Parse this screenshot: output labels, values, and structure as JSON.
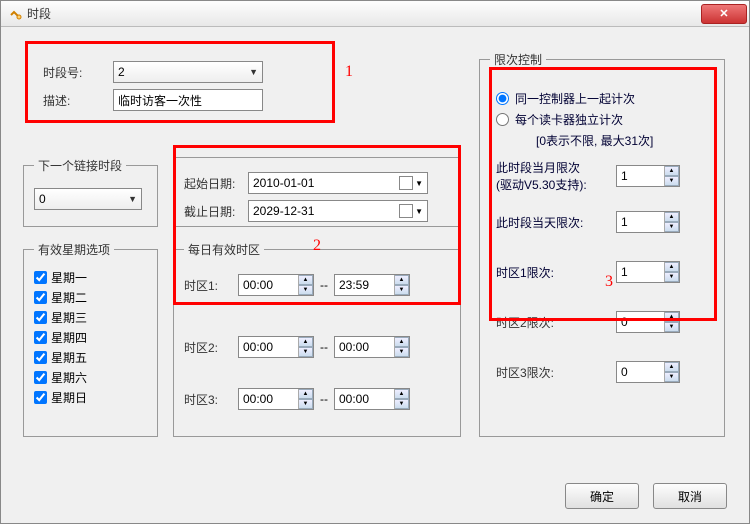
{
  "window": {
    "title": "时段"
  },
  "header": {
    "period_no_label": "时段号:",
    "period_no_value": "2",
    "desc_label": "描述:",
    "desc_value": "临时访客一次性"
  },
  "next_link": {
    "legend": "下一个链接时段",
    "value": "0"
  },
  "weekdays": {
    "legend": "有效星期选项",
    "items": [
      "星期一",
      "星期二",
      "星期三",
      "星期四",
      "星期五",
      "星期六",
      "星期日"
    ]
  },
  "dates": {
    "start_label": "起始日期:",
    "start_value": "2010-01-01",
    "end_label": "截止日期:",
    "end_value": "2029-12-31"
  },
  "timezones": {
    "legend": "每日有效时区",
    "rows": [
      {
        "label": "时区1:",
        "from": "00:00",
        "to": "23:59"
      },
      {
        "label": "时区2:",
        "from": "00:00",
        "to": "00:00"
      },
      {
        "label": "时区3:",
        "from": "00:00",
        "to": "00:00"
      }
    ]
  },
  "limit": {
    "legend": "限次控制",
    "opt_same": "同一控制器上一起计次",
    "opt_each": "每个读卡器独立计次",
    "hint": "[0表示不限, 最大31次]",
    "month_label": "此时段当月限次\n(驱动V5.30支持):",
    "month_value": "1",
    "day_label": "此时段当天限次:",
    "day_value": "1",
    "tz1_label": "时区1限次:",
    "tz1_value": "1",
    "tz2_label": "时区2限次:",
    "tz2_value": "0",
    "tz3_label": "时区3限次:",
    "tz3_value": "0"
  },
  "annotations": {
    "a1": "1",
    "a2": "2",
    "a3": "3"
  },
  "buttons": {
    "ok": "确定",
    "cancel": "取消"
  }
}
